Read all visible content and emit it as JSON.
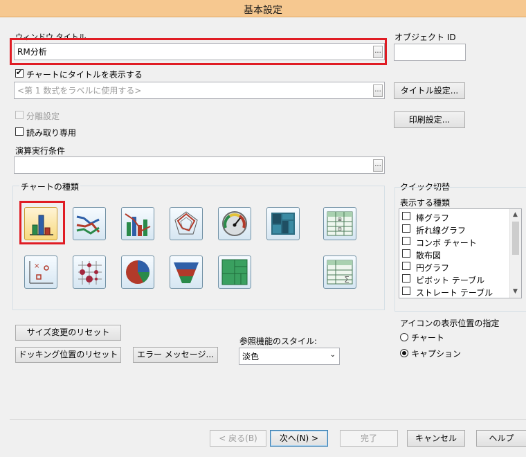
{
  "window": {
    "title": "基本設定"
  },
  "window_title_section": {
    "label": "ウィンドウ タイトル",
    "value": "RM分析",
    "ellipsis": "..."
  },
  "object_id": {
    "label": "オブジェクト ID",
    "value": ""
  },
  "show_title_checkbox": {
    "label": "チャートにタイトルを表示する",
    "checked": true
  },
  "title_formula": {
    "placeholder": "<第 1 数式をラベルに使用する>",
    "ellipsis": "..."
  },
  "title_settings_button": "タイトル設定...",
  "separate_settings": {
    "label": "分離設定",
    "checked": false,
    "disabled": true
  },
  "read_only": {
    "label": "読み取り専用",
    "checked": false
  },
  "print_settings_button": "印刷設定...",
  "calc_condition": {
    "label": "演算実行条件",
    "value": "",
    "ellipsis": "..."
  },
  "chart_types": {
    "label": "チャートの種類",
    "icons": [
      "bar-chart-icon",
      "line-chart-icon",
      "combo-chart-icon",
      "radar-chart-icon",
      "gauge-chart-icon",
      "treemap-chart-icon",
      "pivot-table-icon",
      "scatter-chart-icon",
      "grid-chart-icon",
      "pie-chart-icon",
      "funnel-chart-icon",
      "block-chart-icon",
      "straight-table-icon"
    ],
    "selected": "bar-chart-icon"
  },
  "quick_switch": {
    "label": "クイック切替",
    "list_label": "表示する種類",
    "items": [
      "棒グラフ",
      "折れ線グラフ",
      "コンボ チャート",
      "散布図",
      "円グラフ",
      "ピボット テーブル",
      "ストレート テーブル"
    ]
  },
  "icon_position": {
    "label": "アイコンの表示位置の指定",
    "options": [
      "チャート",
      "キャプション"
    ],
    "selected": "キャプション"
  },
  "reset_size_button": "サイズ変更のリセット",
  "reset_docking_button": "ドッキング位置のリセット",
  "error_message_button": "エラー メッセージ...",
  "reference_style": {
    "label": "参照機能のスタイル:",
    "value": "淡色"
  },
  "footer": {
    "back": "< 戻る(B)",
    "next": "次へ(N) >",
    "finish": "完了",
    "cancel": "キャンセル",
    "help": "ヘルプ"
  },
  "colors": {
    "title_bar": "#f6c890",
    "highlight": "#e01c24"
  }
}
